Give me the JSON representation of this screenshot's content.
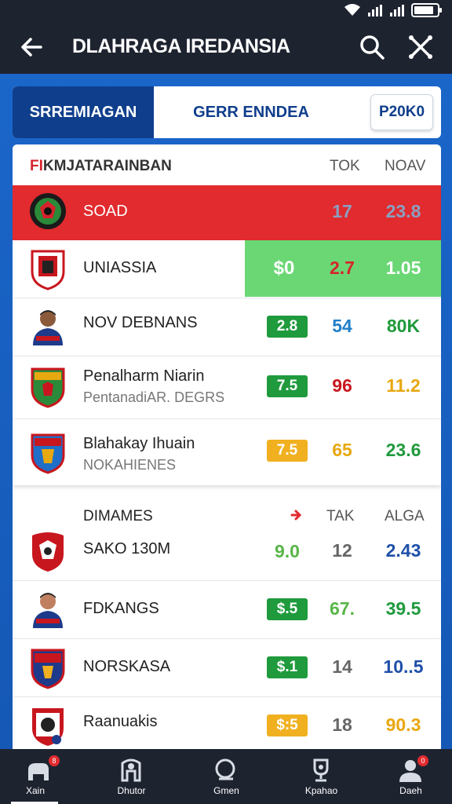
{
  "header": {
    "title": "DLAHRAGA IREDANSIA"
  },
  "tabs": [
    {
      "label": "SRREMIAGAN"
    },
    {
      "label": "GERR ENNDEA"
    },
    {
      "label": "P20K0"
    }
  ],
  "section1": {
    "title_flag": "FI",
    "title_rest": "KMJATARAINBAN",
    "col1": "TOK",
    "col2": "NOAV",
    "rows": [
      {
        "name": "SOAD",
        "v1": "17",
        "v2": "23.8",
        "v1_color": "#8b9fc0",
        "v2_color": "#8b9fc0"
      },
      {
        "name": "UNIASSIA",
        "badge": "$0",
        "v1": "2.7",
        "v2": "1.05",
        "v1_color": "#d6232b",
        "v2_color": "#ffffff"
      },
      {
        "name": "NOV DEBNANS",
        "badge": "2.8",
        "badge_color": "#1f9a3c",
        "v1": "54",
        "v2": "80K",
        "v1_color": "#1f7fc8",
        "v2_color": "#1f9a3c"
      },
      {
        "name": "Penalharm Niarin",
        "sub": "PentanadiAR. DEGRS",
        "badge": "7.5",
        "badge_color": "#1f9a3c",
        "v1": "96",
        "v2": "11.2",
        "v1_color": "#c8161e",
        "v2_color": "#e8a810"
      },
      {
        "name": "Blahakay Ihuain",
        "sub": "NOKAHIENES",
        "badge": "7.5",
        "badge_color": "#f0b020",
        "v1": "65",
        "v2": "23.6",
        "v1_color": "#e8a810",
        "v2_color": "#1f9a3c"
      }
    ]
  },
  "section2": {
    "title": "DIMAMES",
    "col1": "TAK",
    "col2": "ALGA",
    "rows": [
      {
        "name": "SAKO 130M",
        "v0": "9.0",
        "v1": "12",
        "v2": "2.43",
        "v0_color": "#58b548",
        "v1_color": "#666666",
        "v2_color": "#1f4fa8"
      },
      {
        "name": "FDKANGS",
        "badge": "$.5",
        "badge_color": "#1f9a3c",
        "v1": "67.",
        "v2": "39.5",
        "v1_color": "#58b548",
        "v2_color": "#1f9a3c"
      },
      {
        "name": "NORSKASA",
        "badge": "$.1",
        "badge_color": "#1f9a3c",
        "v1": "14",
        "v2": "10..5",
        "v1_color": "#666666",
        "v2_color": "#1f4fa8"
      },
      {
        "name": "Raanuakis",
        "badge": "$:5",
        "badge_color": "#f0b020",
        "v1": "18",
        "v2": "90.3",
        "v1_color": "#666666",
        "v2_color": "#e8a810"
      }
    ]
  },
  "bottom_nav": [
    {
      "label": "Xain",
      "icon": "home-icon",
      "dot": "8"
    },
    {
      "label": "Dhutor",
      "icon": "stats-icon"
    },
    {
      "label": "Gmen",
      "icon": "search-icon"
    },
    {
      "label": "Kpahao",
      "icon": "trophy-icon"
    },
    {
      "label": "Daeh",
      "icon": "profile-icon",
      "dot": "0"
    }
  ],
  "colors": {
    "appbar": "#1e2330",
    "primary": "#0f3e8c",
    "highlight_red": "#e12b2f",
    "highlight_green": "#6bd774"
  }
}
